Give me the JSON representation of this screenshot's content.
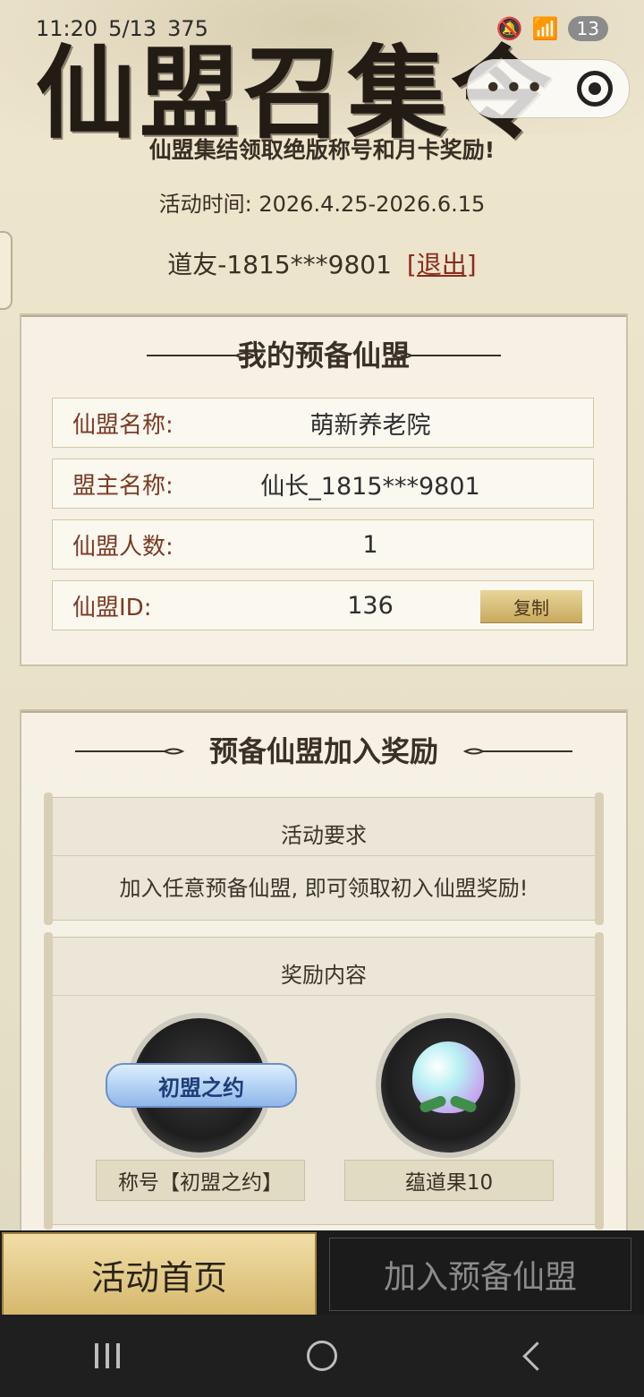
{
  "status_bar": {
    "time": "11:20",
    "date": "5/13",
    "data_rate": "375",
    "battery": "13"
  },
  "header": {
    "title": "仙盟召集令",
    "subtitle": "仙盟集结领取绝版称号和月卡奖励!",
    "time_label": "活动时间: 2026.4.25-2026.6.15",
    "user_name": "道友-1815***9801",
    "logout_label": "[退出]"
  },
  "my_alliance": {
    "title": "我的预备仙盟",
    "rows": [
      {
        "label": "仙盟名称:",
        "value": "萌新养老院"
      },
      {
        "label": "盟主名称:",
        "value": "仙长_1815***9801"
      },
      {
        "label": "仙盟人数:",
        "value": "1"
      },
      {
        "label": "仙盟ID:",
        "value": "136"
      }
    ],
    "copy_label": "复制"
  },
  "rewards": {
    "title": "预备仙盟加入奖励",
    "requirement_title": "活动要求",
    "requirement_text": "加入任意预备仙盟, 即可领取初入仙盟奖励!",
    "content_title": "奖励内容",
    "items": [
      {
        "name": "称号【初盟之约】",
        "badge_text": "初盟之约",
        "icon": "title-badge-icon"
      },
      {
        "name": "蕴道果10",
        "icon": "fruit-icon"
      }
    ]
  },
  "bottom": {
    "home_label": "活动首页",
    "join_label": "加入预备仙盟"
  },
  "system_nav": {
    "recent": "recent-apps-icon",
    "home": "home-icon",
    "back": "back-icon"
  }
}
